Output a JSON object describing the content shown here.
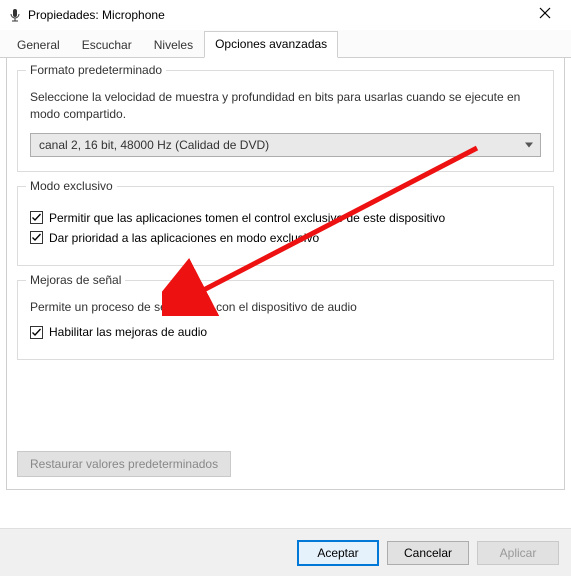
{
  "window": {
    "title": "Propiedades: Microphone"
  },
  "tabs": {
    "general": "General",
    "escuchar": "Escuchar",
    "niveles": "Niveles",
    "avanzadas": "Opciones avanzadas"
  },
  "default_format": {
    "legend": "Formato predeterminado",
    "desc": "Seleccione la velocidad de muestra y profundidad en bits para usarlas cuando se ejecute en modo compartido.",
    "selected": "canal 2, 16 bit, 48000 Hz (Calidad de DVD)"
  },
  "exclusive_mode": {
    "legend": "Modo exclusivo",
    "allow_apps": "Permitir que las aplicaciones tomen el control exclusivo de este dispositivo",
    "give_priority": "Dar prioridad a las aplicaciones en modo exclusivo"
  },
  "signal_enh": {
    "legend": "Mejoras de señal",
    "desc": "Permite un proceso de señal extra con el dispositivo de audio",
    "enable": "Habilitar las mejoras de audio"
  },
  "restore": "Restaurar valores predeterminados",
  "buttons": {
    "accept": "Aceptar",
    "cancel": "Cancelar",
    "apply": "Aplicar"
  }
}
